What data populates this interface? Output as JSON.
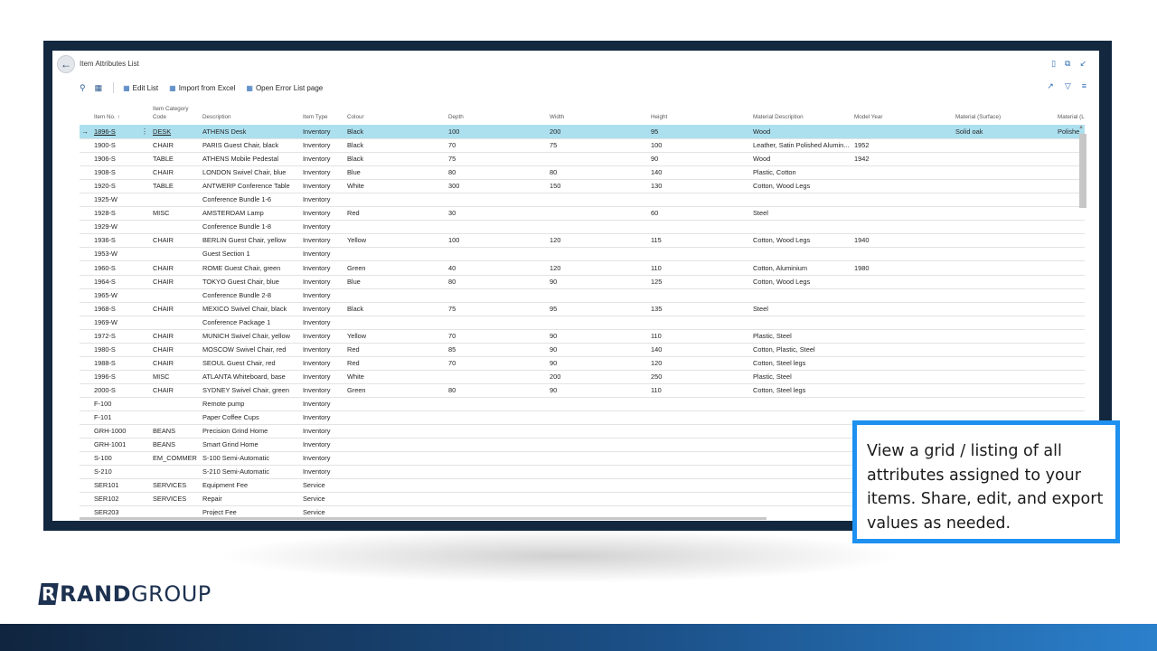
{
  "page": {
    "title": "Item Attributes List",
    "toolbar": {
      "edit_list": "Edit List",
      "import_excel": "Import from Excel",
      "open_error": "Open Error List page"
    }
  },
  "table": {
    "headers": {
      "item_no": "Item No. ↑",
      "cat_line1": "Item Category",
      "cat_line2": "Code",
      "description": "Description",
      "item_type": "Item Type",
      "colour": "Colour",
      "depth": "Depth",
      "width": "Width",
      "height": "Height",
      "material_desc": "Material Description",
      "model_year": "Model Year",
      "material_surface": "Material (Surface)",
      "material_leg": "Material (Leg"
    },
    "rows": [
      {
        "no": "1896-S",
        "cat": "DESK",
        "desc": "ATHENS Desk",
        "type": "Inventory",
        "colour": "Black",
        "depth": "100",
        "width": "200",
        "height": "95",
        "mat": "Wood",
        "year": "",
        "surface": "Solid oak",
        "leg": "Polishe"
      },
      {
        "no": "1900-S",
        "cat": "CHAIR",
        "desc": "PARIS Guest Chair, black",
        "type": "Inventory",
        "colour": "Black",
        "depth": "70",
        "width": "75",
        "height": "100",
        "mat": "Leather, Satin Polished Alumin...",
        "year": "1952",
        "surface": "",
        "leg": ""
      },
      {
        "no": "1906-S",
        "cat": "TABLE",
        "desc": "ATHENS Mobile Pedestal",
        "type": "Inventory",
        "colour": "Black",
        "depth": "75",
        "width": "",
        "height": "90",
        "mat": "Wood",
        "year": "1942",
        "surface": "",
        "leg": ""
      },
      {
        "no": "1908-S",
        "cat": "CHAIR",
        "desc": "LONDON Swivel Chair, blue",
        "type": "Inventory",
        "colour": "Blue",
        "depth": "80",
        "width": "80",
        "height": "140",
        "mat": "Plastic, Cotton",
        "year": "",
        "surface": "",
        "leg": ""
      },
      {
        "no": "1920-S",
        "cat": "TABLE",
        "desc": "ANTWERP Conference Table",
        "type": "Inventory",
        "colour": "White",
        "depth": "300",
        "width": "150",
        "height": "130",
        "mat": "Cotton, Wood Legs",
        "year": "",
        "surface": "",
        "leg": ""
      },
      {
        "no": "1925-W",
        "cat": "",
        "desc": "Conference Bundle 1-6",
        "type": "Inventory",
        "colour": "",
        "depth": "",
        "width": "",
        "height": "",
        "mat": "",
        "year": "",
        "surface": "",
        "leg": ""
      },
      {
        "no": "1928-S",
        "cat": "MISC",
        "desc": "AMSTERDAM Lamp",
        "type": "Inventory",
        "colour": "Red",
        "depth": "30",
        "width": "",
        "height": "60",
        "mat": "Steel",
        "year": "",
        "surface": "",
        "leg": ""
      },
      {
        "no": "1929-W",
        "cat": "",
        "desc": "Conference Bundle 1-8",
        "type": "Inventory",
        "colour": "",
        "depth": "",
        "width": "",
        "height": "",
        "mat": "",
        "year": "",
        "surface": "",
        "leg": ""
      },
      {
        "no": "1936-S",
        "cat": "CHAIR",
        "desc": "BERLIN Guest Chair, yellow",
        "type": "Inventory",
        "colour": "Yellow",
        "depth": "100",
        "width": "120",
        "height": "115",
        "mat": "Cotton, Wood Legs",
        "year": "1940",
        "surface": "",
        "leg": ""
      },
      {
        "no": "1953-W",
        "cat": "",
        "desc": "Guest Section 1",
        "type": "Inventory",
        "colour": "",
        "depth": "",
        "width": "",
        "height": "",
        "mat": "",
        "year": "",
        "surface": "",
        "leg": ""
      },
      {
        "no": "1960-S",
        "cat": "CHAIR",
        "desc": "ROME Guest Chair, green",
        "type": "Inventory",
        "colour": "Green",
        "depth": "40",
        "width": "120",
        "height": "110",
        "mat": "Cotton, Aluminium",
        "year": "1980",
        "surface": "",
        "leg": ""
      },
      {
        "no": "1964-S",
        "cat": "CHAIR",
        "desc": "TOKYO Guest Chair, blue",
        "type": "Inventory",
        "colour": "Blue",
        "depth": "80",
        "width": "90",
        "height": "125",
        "mat": "Cotton, Wood Legs",
        "year": "",
        "surface": "",
        "leg": ""
      },
      {
        "no": "1965-W",
        "cat": "",
        "desc": "Conference Bundle 2-8",
        "type": "Inventory",
        "colour": "",
        "depth": "",
        "width": "",
        "height": "",
        "mat": "",
        "year": "",
        "surface": "",
        "leg": ""
      },
      {
        "no": "1968-S",
        "cat": "CHAIR",
        "desc": "MEXICO Swivel Chair, black",
        "type": "Inventory",
        "colour": "Black",
        "depth": "75",
        "width": "95",
        "height": "135",
        "mat": "Steel",
        "year": "",
        "surface": "",
        "leg": ""
      },
      {
        "no": "1969-W",
        "cat": "",
        "desc": "Conference Package 1",
        "type": "Inventory",
        "colour": "",
        "depth": "",
        "width": "",
        "height": "",
        "mat": "",
        "year": "",
        "surface": "",
        "leg": ""
      },
      {
        "no": "1972-S",
        "cat": "CHAIR",
        "desc": "MUNICH Swivel Chair, yellow",
        "type": "Inventory",
        "colour": "Yellow",
        "depth": "70",
        "width": "90",
        "height": "110",
        "mat": "Plastic, Steel",
        "year": "",
        "surface": "",
        "leg": ""
      },
      {
        "no": "1980-S",
        "cat": "CHAIR",
        "desc": "MOSCOW Swivel Chair, red",
        "type": "Inventory",
        "colour": "Red",
        "depth": "85",
        "width": "90",
        "height": "140",
        "mat": "Cotton, Plastic, Steel",
        "year": "",
        "surface": "",
        "leg": ""
      },
      {
        "no": "1988-S",
        "cat": "CHAIR",
        "desc": "SEOUL Guest Chair, red",
        "type": "Inventory",
        "colour": "Red",
        "depth": "70",
        "width": "90",
        "height": "120",
        "mat": "Cotton, Steel legs",
        "year": "",
        "surface": "",
        "leg": ""
      },
      {
        "no": "1996-S",
        "cat": "MISC",
        "desc": "ATLANTA Whiteboard, base",
        "type": "Inventory",
        "colour": "White",
        "depth": "",
        "width": "200",
        "height": "250",
        "mat": "Plastic, Steel",
        "year": "",
        "surface": "",
        "leg": ""
      },
      {
        "no": "2000-S",
        "cat": "CHAIR",
        "desc": "SYDNEY Swivel Chair, green",
        "type": "Inventory",
        "colour": "Green",
        "depth": "80",
        "width": "90",
        "height": "110",
        "mat": "Cotton, Steel legs",
        "year": "",
        "surface": "",
        "leg": ""
      },
      {
        "no": "F-100",
        "cat": "",
        "desc": "Remote pump",
        "type": "Inventory",
        "colour": "",
        "depth": "",
        "width": "",
        "height": "",
        "mat": "",
        "year": "",
        "surface": "",
        "leg": ""
      },
      {
        "no": "F-101",
        "cat": "",
        "desc": "Paper Coffee Cups",
        "type": "Inventory",
        "colour": "",
        "depth": "",
        "width": "",
        "height": "",
        "mat": "",
        "year": "",
        "surface": "",
        "leg": ""
      },
      {
        "no": "GRH-1000",
        "cat": "BEANS",
        "desc": "Precision Grind Home",
        "type": "Inventory",
        "colour": "",
        "depth": "",
        "width": "",
        "height": "",
        "mat": "",
        "year": "",
        "surface": "",
        "leg": ""
      },
      {
        "no": "GRH-1001",
        "cat": "BEANS",
        "desc": "Smart Grind Home",
        "type": "Inventory",
        "colour": "",
        "depth": "",
        "width": "",
        "height": "",
        "mat": "",
        "year": "",
        "surface": "",
        "leg": ""
      },
      {
        "no": "S-100",
        "cat": "EM_COMMER",
        "desc": "S-100 Semi-Automatic",
        "type": "Inventory",
        "colour": "",
        "depth": "",
        "width": "",
        "height": "",
        "mat": "",
        "year": "",
        "surface": "",
        "leg": ""
      },
      {
        "no": "S-210",
        "cat": "",
        "desc": "S-210 Semi-Automatic",
        "type": "Inventory",
        "colour": "",
        "depth": "",
        "width": "",
        "height": "",
        "mat": "",
        "year": "",
        "surface": "",
        "leg": ""
      },
      {
        "no": "SER101",
        "cat": "SERVICES",
        "desc": "Equipment Fee",
        "type": "Service",
        "colour": "",
        "depth": "",
        "width": "",
        "height": "",
        "mat": "",
        "year": "",
        "surface": "",
        "leg": ""
      },
      {
        "no": "SER102",
        "cat": "SERVICES",
        "desc": "Repair",
        "type": "Service",
        "colour": "",
        "depth": "",
        "width": "",
        "height": "",
        "mat": "",
        "year": "",
        "surface": "",
        "leg": ""
      },
      {
        "no": "SER203",
        "cat": "",
        "desc": "Project Fee",
        "type": "Service",
        "colour": "",
        "depth": "",
        "width": "",
        "height": "",
        "mat": "",
        "year": "",
        "surface": "",
        "leg": ""
      }
    ]
  },
  "callout": {
    "text": "View a grid / listing of all attributes assigned to your items. Share, edit, and export values as needed."
  },
  "brand": {
    "mark": "R",
    "part1": "RAND",
    "part2": "GROUP"
  },
  "colors": {
    "selected_row": "#ace0ef",
    "frame": "#13283f",
    "callout_border": "#1e90ef",
    "brand_navy": "#1d3150"
  }
}
